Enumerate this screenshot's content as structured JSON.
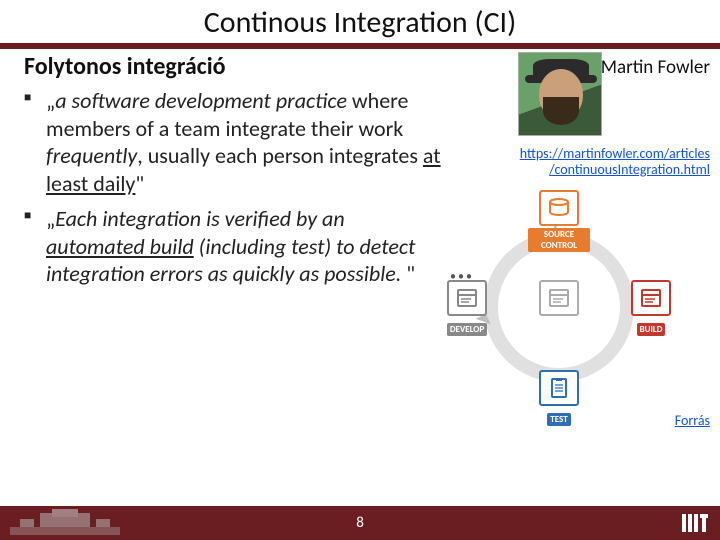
{
  "title": "Continous Integration (CI)",
  "subtitle": "Folytonos integráció",
  "bullets": [
    {
      "pre": "„",
      "it1": "a software development practice",
      "mid1": " where members of a team integrate their work ",
      "it2": "frequently",
      "mid2": ", usually each person integrates ",
      "u1": "at least daily",
      "post": "\""
    },
    {
      "pre": "„",
      "it1": "Each integration is verified by an ",
      "u1": "automated build",
      "mid1": " (including test) to detect integration errors as quickly as possible.",
      "post": " \""
    }
  ],
  "author": "Martin Fowler",
  "link": {
    "line1": "https://martinfowler.com/articles",
    "line2": "/continuousIntegration.html"
  },
  "diagram": {
    "top": "SOURCE CONTROL",
    "right": "BUILD",
    "bottom": "TEST",
    "left": "DEVELOP"
  },
  "forras": "Forrás",
  "page": "8"
}
